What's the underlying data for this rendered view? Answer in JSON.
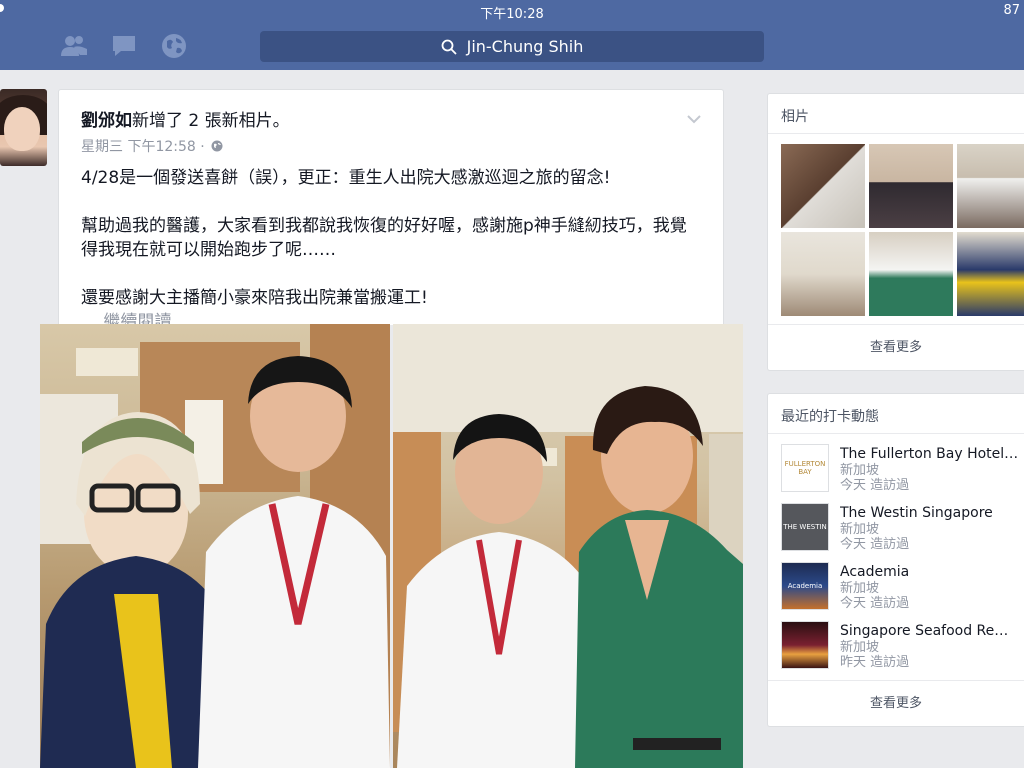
{
  "status_bar": {
    "time": "下午10:28",
    "battery": "87"
  },
  "search": {
    "value": "Jin-Chung Shih"
  },
  "nav_icons": [
    "friends-icon",
    "messages-icon",
    "globe-icon"
  ],
  "post": {
    "author": "劉邠如",
    "action": "新增了 2 張新相片。",
    "timestamp": "星期三 下午12:58 ·",
    "privacy_icon": "globe-icon",
    "paragraphs": [
      "4/28是一個發送喜餅（誤），更正：重生人出院大感激巡迴之旅的留念!",
      "幫助過我的醫護，大家看到我都說我恢復的好好喔，感謝施p神手縫紉技巧，我覺得我現在就可以開始跑步了呢……",
      "還要感謝大主播簡小豪來陪我出院兼當搬運工!"
    ],
    "read_more": "… 繼續閱讀"
  },
  "sidebar_photos": {
    "title": "相片",
    "see_more": "查看更多"
  },
  "sidebar_checkins": {
    "title": "最近的打卡動態",
    "see_more": "查看更多",
    "items": [
      {
        "name": "The Fullerton Bay Hotel…",
        "location": "新加坡",
        "when": "今天 造訪過",
        "logo_text": "FULLERTON BAY"
      },
      {
        "name": "The Westin Singapore",
        "location": "新加坡",
        "when": "今天 造訪過",
        "logo_text": "THE WESTIN"
      },
      {
        "name": "Academia",
        "location": "新加坡",
        "when": "今天 造訪過",
        "logo_text": "Academia"
      },
      {
        "name": "Singapore Seafood Re…",
        "location": "新加坡",
        "when": "昨天 造訪過",
        "logo_text": ""
      }
    ]
  },
  "colors": {
    "topbar": "#4e69a2",
    "searchbox": "#3b5284",
    "background": "#e9eaed",
    "link_gray": "#9197a3"
  }
}
